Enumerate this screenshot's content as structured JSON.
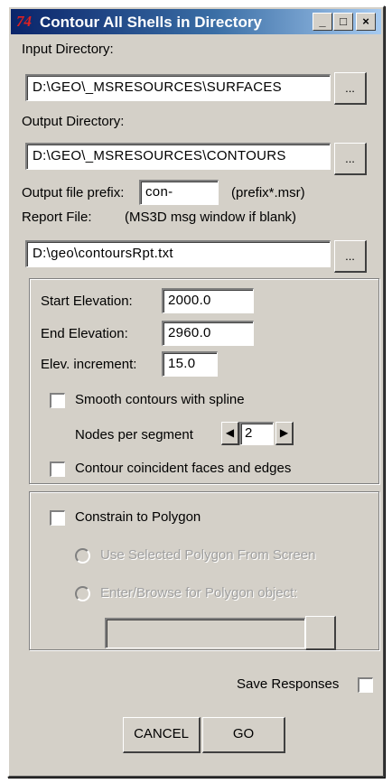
{
  "window": {
    "title": "Contour All Shells in Directory",
    "icon_text": "74",
    "minimize": "_",
    "maximize": "□",
    "close": "×"
  },
  "input_dir": {
    "label": "Input Directory:",
    "value": "D:\\GEO\\_MSRESOURCES\\SURFACES",
    "browse": "..."
  },
  "output_dir": {
    "label": "Output Directory:",
    "value": "D:\\GEO\\_MSRESOURCES\\CONTOURS",
    "browse": "..."
  },
  "prefix": {
    "label": "Output file prefix:",
    "value": "con-",
    "hint": "(prefix*.msr)"
  },
  "report": {
    "label": "Report File:",
    "hint": "(MS3D msg window if blank)",
    "value": "D:\\geo\\contoursRpt.txt",
    "browse": "..."
  },
  "elevation": {
    "start_label": "Start Elevation:",
    "start_value": "2000.0",
    "end_label": "End Elevation:",
    "end_value": "2960.0",
    "inc_label": "Elev. increment:",
    "inc_value": "15.0",
    "smooth_label": "Smooth contours with spline",
    "smooth_checked": false,
    "nodes_label": "Nodes per segment",
    "nodes_value": "2",
    "coincident_label": "Contour coincident faces and edges",
    "coincident_checked": false
  },
  "polygon": {
    "constrain_label": "Constrain to Polygon",
    "constrain_checked": false,
    "option_selected": "Use Selected Polygon From Screen",
    "option_browse": "Enter/Browse for Polygon object:",
    "value": ""
  },
  "save_responses": {
    "label": "Save Responses",
    "checked": false
  },
  "buttons": {
    "cancel": "CANCEL",
    "go": "GO"
  }
}
